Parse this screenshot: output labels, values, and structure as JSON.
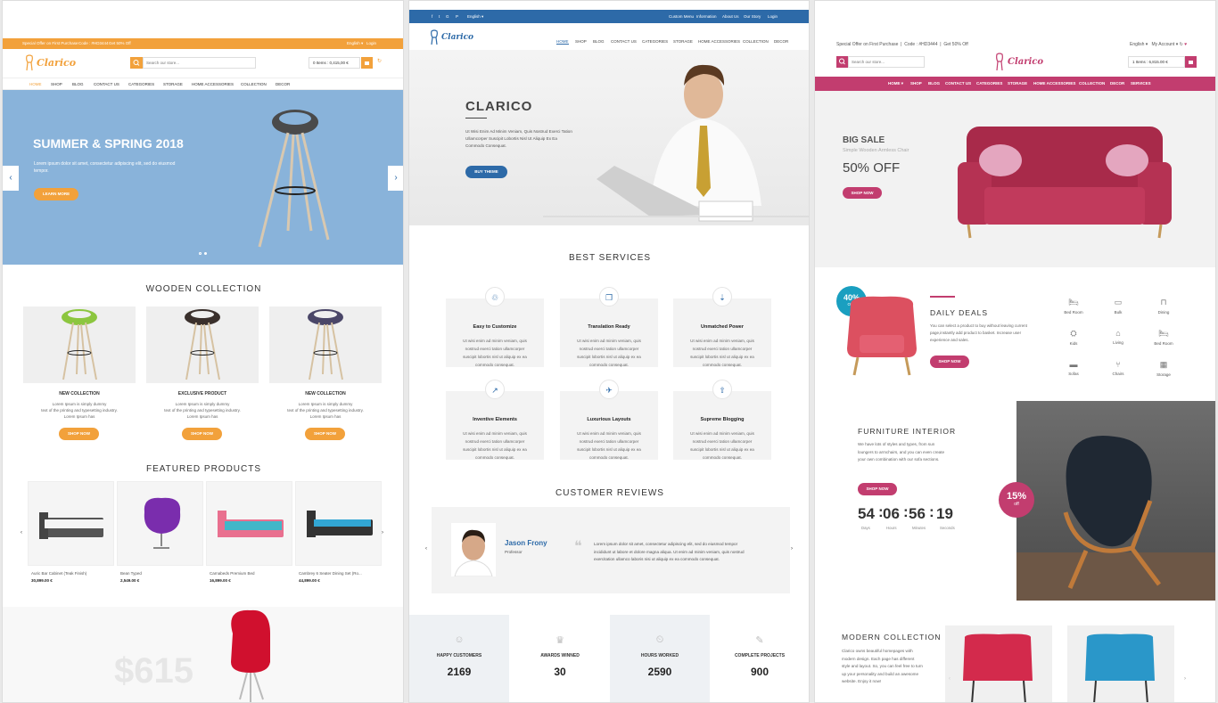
{
  "panel1": {
    "topbar": {
      "offer": "Special Offer on First Purchase",
      "code": "Code : #HD3444",
      "discount": "Get 50% Off",
      "language": "English ▾",
      "login": "Login"
    },
    "logo": "Clarico",
    "search_placeholder": "Search our store...",
    "cart": "0 Items : 0,415,00 €",
    "nav": [
      "HOME",
      "SHOP",
      "BLOG",
      "CONTACT US",
      "CATEGORIES",
      "STORAGE",
      "HOME ACCESSORIES",
      "COLLECTION",
      "DECOR"
    ],
    "hero": {
      "title": "SUMMER & SPRING 2018",
      "text": "Lorem ipsum dolor sit amet, consectetur adipiscing elit, sed do eiusmod tempor.",
      "button": "LEARN MORE"
    },
    "wooden_title": "WOODEN COLLECTION",
    "wooden": [
      {
        "title": "NEW COLLECTION",
        "l1": "Lorem Ipsum is simply dummy",
        "l2": "text of the printing and typesetting industry.",
        "l3": "Lorem Ipsum has",
        "button": "SHOP NOW"
      },
      {
        "title": "EXCLUSIVE PRODUCT",
        "l1": "Lorem Ipsum is simply dummy",
        "l2": "text of the printing and typesetting industry.",
        "l3": "Lorem Ipsum has",
        "button": "SHOP NOW"
      },
      {
        "title": "NEW COLLECTION",
        "l1": "Lorem Ipsum is simply dummy",
        "l2": "text of the printing and typesetting industry.",
        "l3": "Lorem Ipsum has",
        "button": "SHOP NOW"
      }
    ],
    "featured_title": "FEATURED PRODUCTS",
    "featured": [
      {
        "name": "Auric Bar Cabinet (Teak Finish)",
        "price": "30,899.00 €"
      },
      {
        "name": "Bean Typed",
        "price": "2,549.00 €"
      },
      {
        "name": "Carnabeds Premium Bed",
        "price": "16,899.00 €"
      },
      {
        "name": "Cambrey 6 Seater Dining Set (Ro...",
        "price": "44,899.00 €"
      }
    ],
    "promo_price": "$615"
  },
  "panel2": {
    "topbar": {
      "language": "English ▾",
      "links": [
        "Custom Menu",
        "Information",
        "About Us",
        "Our Story",
        "Login"
      ]
    },
    "logo": "Clarico",
    "nav": [
      "HOME",
      "SHOP",
      "BLOG",
      "CONTACT US",
      "CATEGORIES",
      "STORAGE",
      "HOME ACCESSORIES",
      "COLLECTION",
      "DECOR"
    ],
    "hero": {
      "title": "CLARICO",
      "l1": "Ut Wisi Enim Ad Minim Veniam, Quis Nostrud Exerci Tation",
      "l2": "Ullamcorper Suscipit Lobortis Nisl Ut Aliquip Ex Ea",
      "l3": "Commodo Consequat.",
      "button": "BUY THEME"
    },
    "services_title": "BEST SERVICES",
    "service_text": {
      "l1": "Ut wisi enim ad minim veniam, quis",
      "l2": "nostrud exerci tation ullamcorper",
      "l3": "suscipit lobortis nisl ut aliquip ex ea",
      "l4": "commodo consequat."
    },
    "services": [
      "Easy to Customize",
      "Translation Ready",
      "Unmatched Power",
      "Inventive Elements",
      "Luxurious Layouts",
      "Supreme Blogging"
    ],
    "reviews_title": "CUSTOMER REVIEWS",
    "review": {
      "name": "Jason Frony",
      "role": "Professor",
      "l1": "Lorem ipsum dolor sit amet, consectetur adipiscing elit, sed do eiusmod tempor",
      "l2": "incididunt ut labore et dolore magna aliqua. Ut enim ad minim veniam, quis nostrud",
      "l3": "exercitation ullamco laboris nisi ut aliquip ex ea commodo consequat."
    },
    "stats": [
      {
        "label": "HAPPY CUSTOMERS",
        "value": "2169"
      },
      {
        "label": "AWARDS WINNED",
        "value": "30"
      },
      {
        "label": "HOURS WORKED",
        "value": "2590"
      },
      {
        "label": "COMPLETE PROJECTS",
        "value": "900"
      }
    ]
  },
  "panel3": {
    "topbar": {
      "offer": "Special Offer on First Purchase",
      "code": "Code : #HD3444",
      "discount": "Get 50% Off",
      "language": "English ▾",
      "account": "My Account ▾"
    },
    "logo": "Clarico",
    "search_placeholder": "Search our store...",
    "cart": "1 Items : 6,815.00 €",
    "nav": [
      "HOME ▾",
      "SHOP",
      "BLOG",
      "CONTACT US",
      "CATEGORIES",
      "STORAGE",
      "HOME ACCESSORIES",
      "COLLECTION",
      "DECOR",
      "SERVICES"
    ],
    "hero": {
      "title": "BIG SALE",
      "sub": "Simple Wooden Armless Chair",
      "offer": "50% OFF",
      "button": "SHOP NOW"
    },
    "deals": {
      "badge_pct": "40%",
      "badge_off": "OFF",
      "title": "DAILY DEALS",
      "l1": "You can select a product to buy without leaving current",
      "l2": "page,instantly add product to basket. Increase user",
      "l3": "experience and sales.",
      "button": "SHOP NOW"
    },
    "categories": [
      "Bed Room",
      "Bulk",
      "Dining",
      "Kids",
      "Living",
      "Bed Room",
      "Sofas",
      "Chairs",
      "Storage"
    ],
    "interior": {
      "title": "FURNITURE INTERIOR",
      "l1": "We have lots of styles and types, from sun",
      "l2": "loungers to armchairs, and you can even create",
      "l3": "your own combination with our sofa sections.",
      "button": "SHOP NOW",
      "badge_pct": "15%",
      "badge_off": "off"
    },
    "countdown": [
      {
        "v": "54",
        "l": "Days"
      },
      {
        "v": "06",
        "l": "Hours"
      },
      {
        "v": "56",
        "l": "Minutes"
      },
      {
        "v": "19",
        "l": "Seconds"
      }
    ],
    "modern": {
      "title": "MODERN COLLECTION",
      "l1": "Clarico owns beautiful homepages with",
      "l2": "modern design. Each page has different",
      "l3": "style and layout. So, you can feel free to turn",
      "l4": "up your personality and build an awesome",
      "l5": "website. Enjoy it now!"
    }
  }
}
